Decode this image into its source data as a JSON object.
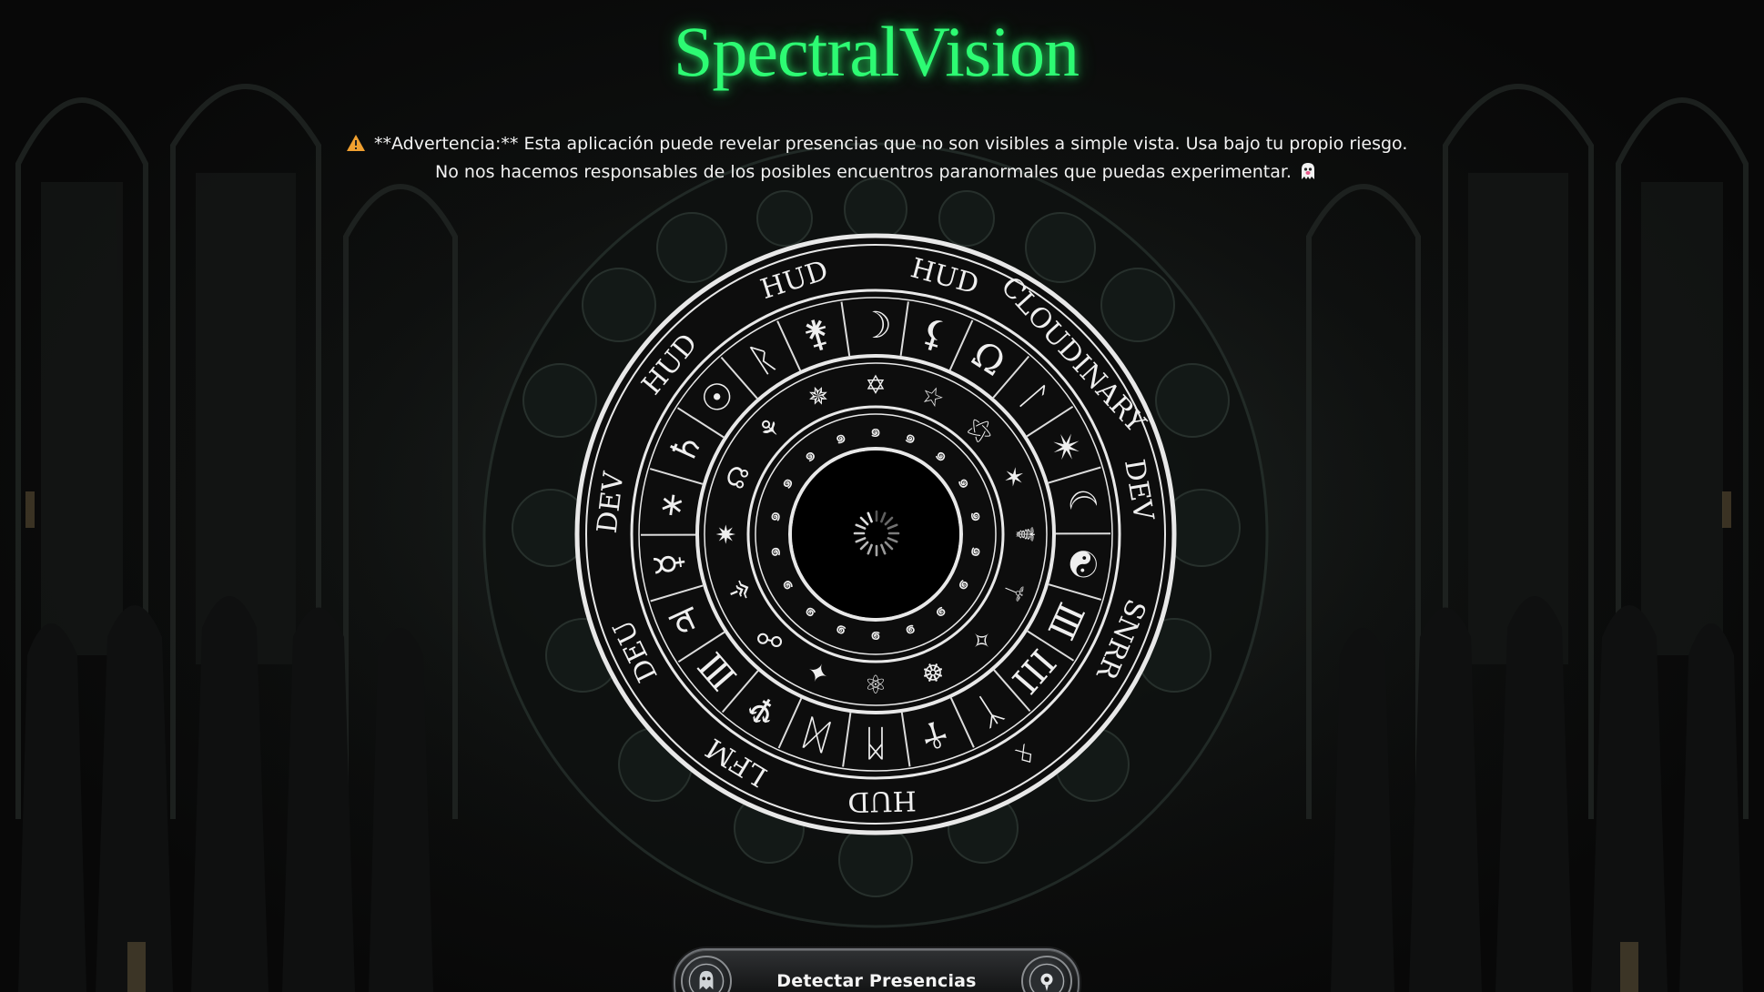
{
  "app": {
    "title": "SpectralVision"
  },
  "warning": {
    "line1": "**Advertencia:** Esta aplicación puede revelar presencias que no son visibles a simple vista. Usa bajo tu propio riesgo.",
    "line2": "No nos hacemos responsables de los posibles encuentros paranormales que puedas experimentar.",
    "leading_icon": "warning-triangle-icon",
    "trailing_icon": "ghost-icon"
  },
  "wheel": {
    "outer_text": [
      "HUD",
      "CLOUDINARY",
      "DEV",
      "SNRR",
      "ᛟ",
      "HUD",
      "LFM",
      "DEU",
      "DEV",
      "HUD",
      "HUD"
    ],
    "status": "loading"
  },
  "action": {
    "detect_label": "Detectar Presencias",
    "left_icon": "spirit-icon",
    "right_icon": "eye-icon"
  },
  "colors": {
    "title": "#2dfb73",
    "background": "#090909",
    "wheel_line": "#e9e9e9",
    "warning_icon": "#f0a030",
    "ghost_icon": "#e85a8a"
  }
}
